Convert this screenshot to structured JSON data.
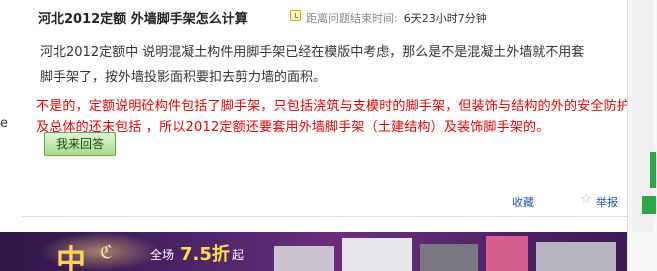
{
  "question": {
    "title": "河北2012定额 外墙脚手架怎么计算",
    "time_label": "距离问题结束时间:",
    "time_value": "6天23小时7分钟",
    "body": "河北2012定额中 说明混凝土构件用脚手架已经在模版中考虑，那么是不是混凝土外墙就不用套脚手架了，按外墙投影面积要扣去剪力墙的面积。"
  },
  "actions": {
    "answer_button": "我来回答",
    "favorite": "收藏",
    "report": "举报"
  },
  "overlay": {
    "answer_text": "不是的，定额说明砼构件包括了脚手架，只包括浇筑与支模时的脚手架，但装饰与结构的外的安全防护及总体的还未包括 ，所以2012定额还要套用外墙脚手架（土建结构）及装饰脚手架的。"
  },
  "left_edge": {
    "glyph": "e"
  },
  "banner": {
    "big_char": "中",
    "swirl": "ℭ",
    "sale_prefix": "全场",
    "sale_value": "7.5折",
    "sale_suffix": "起"
  },
  "colors": {
    "answer_text": "#ee0000",
    "link": "#2255aa",
    "button_green": "#a9d98f",
    "banner_purple": "#4a2468"
  },
  "icons": [
    "clock-icon",
    "star-icon"
  ]
}
